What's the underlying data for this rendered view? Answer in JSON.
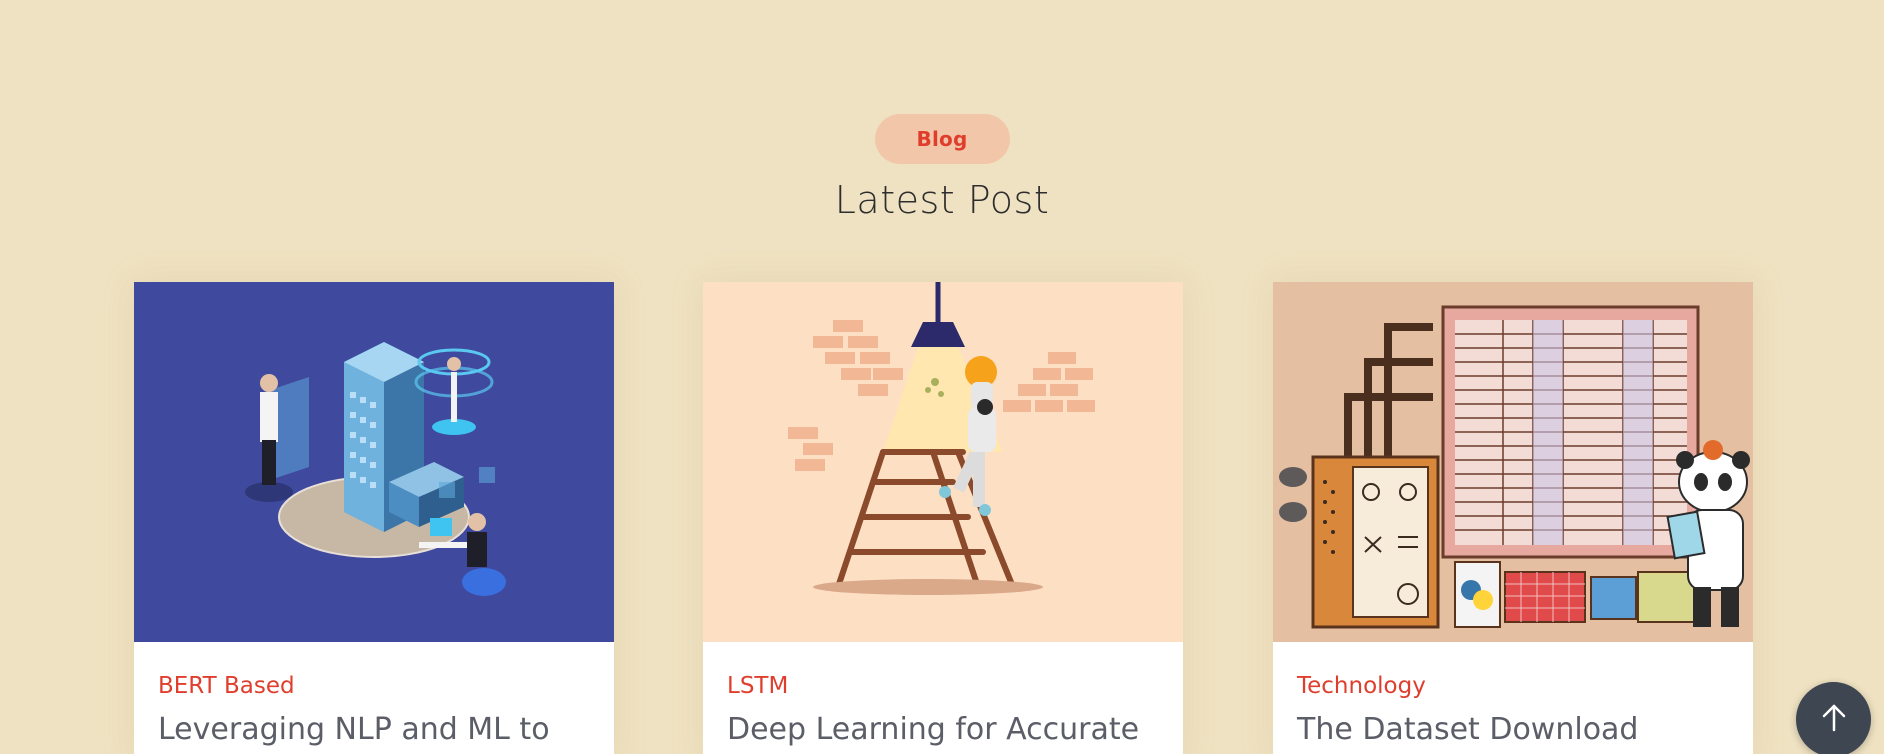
{
  "section": {
    "badge": "Blog",
    "heading": "Latest Post"
  },
  "posts": [
    {
      "category": "BERT Based",
      "title": "Leveraging NLP and ML to",
      "image_icon": "nlp-illustration",
      "image_bg": "#3f4a9e"
    },
    {
      "category": "LSTM",
      "title": "Deep Learning for Accurate",
      "image_icon": "robot-ladder-illustration",
      "image_bg": "#fde0c3"
    },
    {
      "category": "Technology",
      "title": "The Dataset Download",
      "image_icon": "panda-dataset-illustration",
      "image_bg": "#e5bfa1"
    }
  ],
  "scroll_top": {
    "icon": "arrow-up-icon"
  },
  "colors": {
    "page_bg": "#efe2c2",
    "accent": "#e03e2d",
    "pill_bg": "#f2c7a9",
    "title_text": "#5b5e67"
  }
}
